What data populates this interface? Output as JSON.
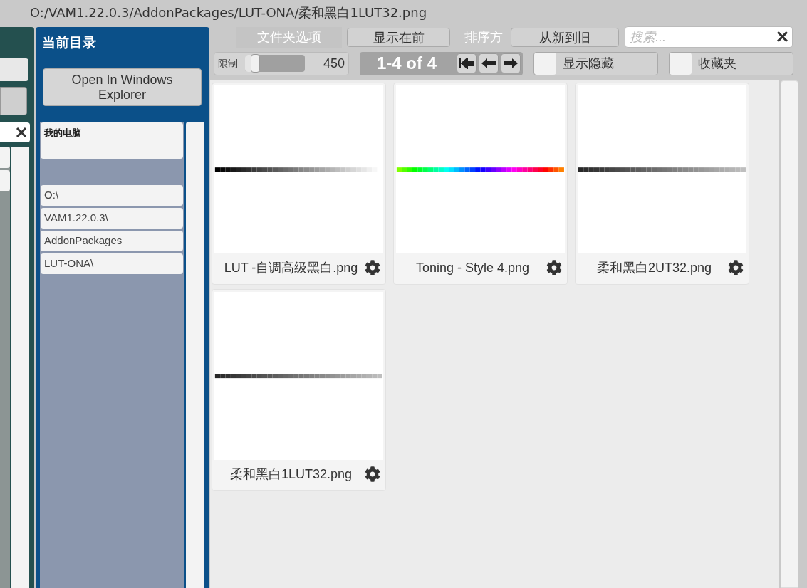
{
  "window": {
    "title": "O:/VAM1.22.0.3/AddonPackages/LUT-ONA/柔和黑白1LUT32.png"
  },
  "directory_panel": {
    "title": "当前目录",
    "open_button": "Open In Windows Explorer",
    "root": "我的电脑",
    "path": [
      "O:\\",
      "VAM1.22.0.3\\",
      "AddonPackages",
      "LUT-ONA\\"
    ]
  },
  "toolbar": {
    "folder_options_label": "文件夹选项",
    "show_first_button": "显示在前",
    "sort_label": "排序方",
    "sort_button": "从新到旧",
    "search": {
      "placeholder": "搜索..."
    },
    "limit": {
      "label": "限制",
      "level": 0.12,
      "value": "450"
    },
    "pager": "1-4 of 4",
    "toggles": [
      {
        "label": "显示隐藏",
        "checked": false
      },
      {
        "label": "收藏夹",
        "checked": false
      }
    ]
  },
  "files": [
    {
      "name": "LUT -自调高级黑白.png"
    },
    {
      "name": "Toning - Style 4.png"
    },
    {
      "name": "柔和黑白2UT32.png"
    },
    {
      "name": "柔和黑白1LUT32.png"
    }
  ]
}
